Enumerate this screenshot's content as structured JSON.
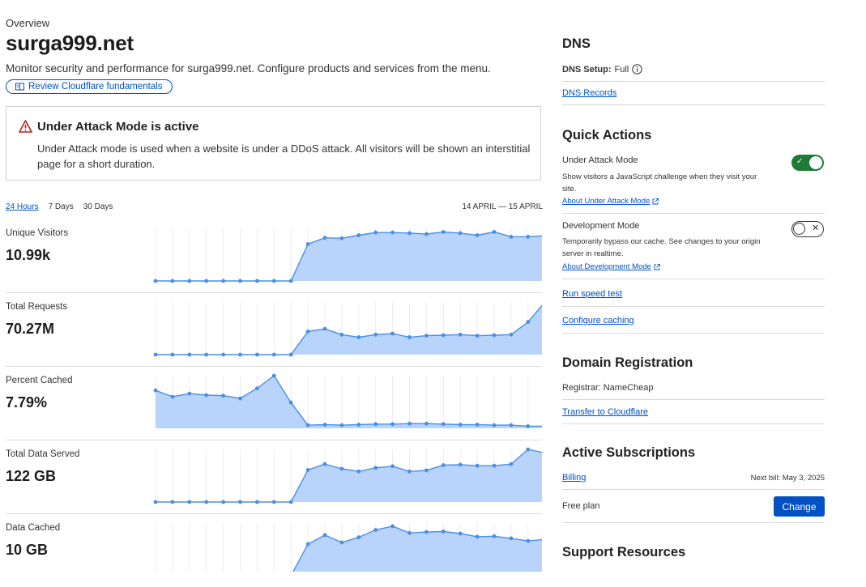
{
  "header": {
    "breadcrumb": "Overview",
    "title": "surga999.net",
    "subtitle": "Monitor security and performance for surga999.net. Configure products and services from the menu.",
    "fundamentals_link": "Review Cloudflare fundamentals"
  },
  "alert": {
    "title": "Under Attack Mode is active",
    "body": "Under Attack mode is used when a website is under a DDoS attack. All visitors will be shown an interstitial page for a short duration."
  },
  "time_range": {
    "tabs": [
      "24 Hours",
      "7 Days",
      "30 Days"
    ],
    "active": "24 Hours",
    "range_text": "14 APRIL — 15 APRIL"
  },
  "metrics": [
    {
      "label": "Unique Visitors",
      "value": "10.99k"
    },
    {
      "label": "Total Requests",
      "value": "70.27M"
    },
    {
      "label": "Percent Cached",
      "value": "7.79%"
    },
    {
      "label": "Total Data Served",
      "value": "122 GB"
    },
    {
      "label": "Data Cached",
      "value": "10 GB"
    }
  ],
  "chart_data": [
    {
      "type": "area",
      "title": "Unique Visitors",
      "y": [
        0,
        0,
        0,
        0,
        0,
        0,
        0,
        0,
        0,
        0.7,
        0.82,
        0.81,
        0.87,
        0.92,
        0.92,
        0.91,
        0.89,
        0.93,
        0.91,
        0.87,
        0.93,
        0.84,
        0.84,
        0.86
      ]
    },
    {
      "type": "area",
      "title": "Total Requests",
      "y": [
        0,
        0,
        0,
        0,
        0,
        0,
        0,
        0,
        0,
        0.44,
        0.49,
        0.38,
        0.33,
        0.38,
        0.4,
        0.33,
        0.36,
        0.37,
        0.38,
        0.36,
        0.37,
        0.38,
        0.62,
        1.0
      ]
    },
    {
      "type": "area",
      "title": "Percent Cached",
      "y": [
        0.72,
        0.6,
        0.66,
        0.63,
        0.62,
        0.57,
        0.76,
        1.0,
        0.49,
        0.06,
        0.07,
        0.06,
        0.07,
        0.08,
        0.08,
        0.09,
        0.09,
        0.08,
        0.07,
        0.07,
        0.06,
        0.06,
        0.04,
        0.04
      ]
    },
    {
      "type": "area",
      "title": "Total Data Served",
      "y": [
        0,
        0,
        0,
        0,
        0,
        0,
        0,
        0,
        0,
        0.61,
        0.72,
        0.63,
        0.58,
        0.65,
        0.68,
        0.58,
        0.6,
        0.7,
        0.71,
        0.69,
        0.69,
        0.72,
        1.0,
        0.93
      ]
    },
    {
      "type": "area",
      "title": "Data Cached",
      "y": [
        0,
        0,
        0,
        0,
        0,
        0,
        0,
        0,
        0,
        0.6,
        0.77,
        0.63,
        0.73,
        0.87,
        0.94,
        0.81,
        0.83,
        0.84,
        0.8,
        0.74,
        0.75,
        0.71,
        0.66,
        0.69
      ]
    }
  ],
  "dns": {
    "title": "DNS",
    "setup_label": "DNS Setup:",
    "setup_value": "Full",
    "records_link": "DNS Records"
  },
  "quick_actions": {
    "title": "Quick Actions",
    "under_attack": {
      "label": "Under Attack Mode",
      "desc": "Show visitors a JavaScript challenge when they visit your site.",
      "link": "About Under Attack Mode",
      "enabled": true
    },
    "dev_mode": {
      "label": "Development Mode",
      "desc": "Temporarily bypass our cache. See changes to your origin server in realtime.",
      "link": "About Development Mode",
      "enabled": false
    },
    "speed_test": "Run speed test",
    "configure_caching": "Configure caching"
  },
  "domain_registration": {
    "title": "Domain Registration",
    "registrar": "Registrar: NameCheap",
    "transfer_link": "Transfer to Cloudflare"
  },
  "subscriptions": {
    "title": "Active Subscriptions",
    "billing_link": "Billing",
    "next_bill": "Next bill: May 3, 2025",
    "plan": "Free plan",
    "change_button": "Change"
  },
  "support": {
    "title": "Support Resources"
  },
  "colors": {
    "accent": "#0051c3",
    "chart_fill": "#b8d4fb",
    "chart_line": "#4a8ee8",
    "toggle_on": "#1e7b35",
    "alert_red": "#b42318"
  }
}
